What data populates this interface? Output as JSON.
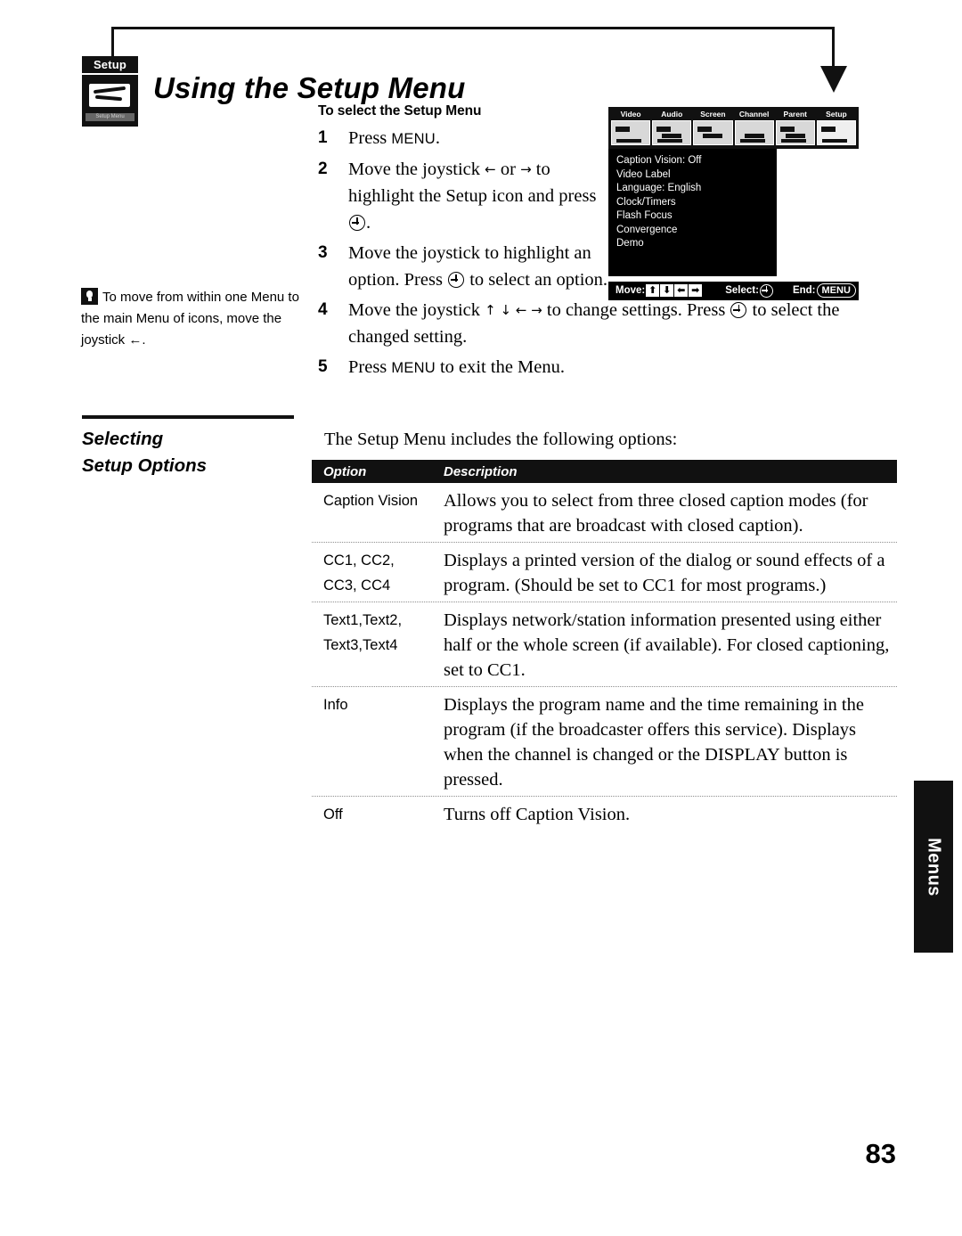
{
  "page": {
    "number": "83",
    "edge_tab_label": "Menus"
  },
  "header": {
    "badge_label": "Setup",
    "badge_caption": "Setup Menu",
    "title": "Using the Setup Menu"
  },
  "procedure": {
    "heading": "To select the Setup Menu",
    "steps": [
      {
        "num": "1",
        "text_before": "Press ",
        "smallcaps": "MENU",
        "text_after": "."
      },
      {
        "num": "2",
        "text_before": "Move the joystick ",
        "arrow_a": "←",
        "mid": " or ",
        "arrow_b": "→",
        "text_after": " to highlight the Setup icon and press ",
        "button": "select-button",
        "tail": "."
      },
      {
        "num": "3",
        "text_before": "Move the joystick to highlight an option. Press ",
        "button": "select-button",
        "text_after": " to select an option."
      },
      {
        "num": "4",
        "text_before": "Move the joystick ",
        "arrows": "↑ ↓ ← →",
        "mid": " to change settings. Press ",
        "button": "select-button",
        "text_after": " to select the changed setting."
      },
      {
        "num": "5",
        "text_before": "Press ",
        "smallcaps": "MENU",
        "text_after": " to exit the Menu."
      }
    ]
  },
  "tip": {
    "icon": "lightbulb-icon",
    "text": "To move from within one Menu to the main Menu of icons, move the joystick ←."
  },
  "section": {
    "title_line1": "Selecting",
    "title_line2": "Setup Options",
    "intro": "The Setup Menu includes the following options:"
  },
  "options_table": {
    "headers": {
      "option": "Option",
      "description": "Description"
    },
    "rows": [
      {
        "option": "Caption Vision",
        "description": "Allows you to select from three closed caption modes (for programs that are broadcast with closed caption).",
        "divider": false
      },
      {
        "option": "CC1, CC2,\nCC3, CC4",
        "description": "Displays a printed version of the dialog or sound effects of a program. (Should be set to CC1 for most programs.)",
        "divider": true
      },
      {
        "option": "Text1,Text2,\nText3,Text4",
        "description": "Displays network/station information presented using either half or the whole screen (if available). For closed captioning, set to CC1.",
        "divider": true
      },
      {
        "option": "Info",
        "description": "Displays the program name and the time remaining in the program (if the broadcaster offers this service). Displays when the channel is changed or the DISPLAY button is pressed.",
        "divider": true
      },
      {
        "option": "Off",
        "description": "Turns off Caption Vision.",
        "divider": true
      }
    ]
  },
  "tv_screen": {
    "tabs": [
      {
        "label": "Video",
        "icon": "video-icon",
        "selected": false
      },
      {
        "label": "Audio",
        "icon": "audio-icon",
        "selected": false
      },
      {
        "label": "Screen",
        "icon": "screen-icon",
        "selected": false
      },
      {
        "label": "Channel",
        "icon": "channel-icon",
        "selected": false
      },
      {
        "label": "Parent",
        "icon": "parent-icon",
        "selected": false
      },
      {
        "label": "Setup",
        "icon": "setup-icon",
        "selected": true
      }
    ],
    "menu_items": [
      "Caption Vision: Off",
      "Video Label",
      "Language: English",
      "Clock/Timers",
      "Flash Focus",
      "Convergence",
      "Demo"
    ],
    "status_bar": {
      "move_label": "Move:",
      "keys": [
        "⬆",
        "⬇",
        "⬅",
        "➡"
      ],
      "select_label": "Select:",
      "end_label": "End:",
      "end_button": "MENU"
    }
  },
  "colors": {
    "ink": "#111111",
    "paper": "#ffffff",
    "rule": "#8e8e8e"
  }
}
